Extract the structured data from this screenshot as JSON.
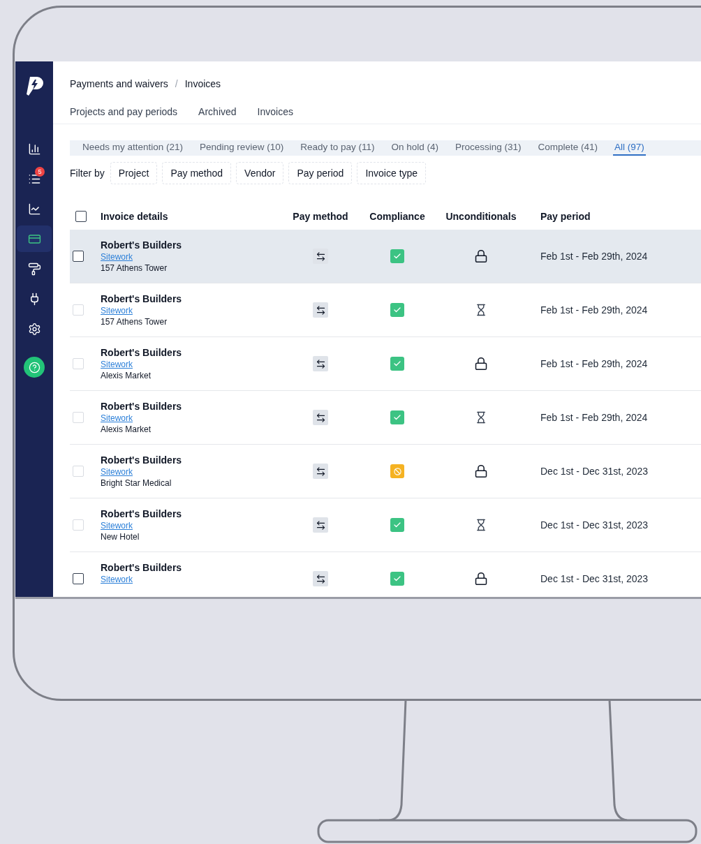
{
  "sidebar": {
    "items": [
      {
        "selected": false
      },
      {
        "selected": false,
        "badge": "5"
      },
      {
        "selected": false
      },
      {
        "selected": true
      },
      {
        "selected": false
      },
      {
        "selected": false
      },
      {
        "selected": false
      }
    ]
  },
  "breadcrumb": [
    "Payments and waivers",
    "Invoices"
  ],
  "breadcrumb_separator": "/",
  "subnav": [
    {
      "label": "Projects and pay periods"
    },
    {
      "label": "Archived"
    },
    {
      "label": "Invoices"
    }
  ],
  "status_tabs": [
    {
      "label": "Needs my attention (21)",
      "selected": false
    },
    {
      "label": "Pending review (10)",
      "selected": false
    },
    {
      "label": "Ready to pay (11)",
      "selected": false
    },
    {
      "label": "On hold (4)",
      "selected": false
    },
    {
      "label": "Processing (31)",
      "selected": false
    },
    {
      "label": "Complete (41)",
      "selected": false
    },
    {
      "label": "All (97)",
      "selected": true
    }
  ],
  "filter": {
    "label": "Filter by",
    "chips": [
      "Project",
      "Pay method",
      "Vendor",
      "Pay period",
      "Invoice type"
    ]
  },
  "table": {
    "header_checkbox": {
      "checked": false
    },
    "columns": [
      "Invoice details",
      "Pay method",
      "Compliance",
      "Unconditionals",
      "Pay period"
    ],
    "rows": [
      {
        "highlighted": true,
        "disabled": false,
        "vendor": "Robert's Builders",
        "trade": "Sitework",
        "project": "157 Athens Tower",
        "compliance": {
          "kind": "ok"
        },
        "unconditional": {
          "kind": "lock"
        },
        "pay_period": "Feb 1st - Feb 29th, 2024"
      },
      {
        "highlighted": false,
        "disabled": true,
        "vendor": "Robert's Builders",
        "trade": "Sitework",
        "project": "157 Athens Tower",
        "compliance": {
          "kind": "ok"
        },
        "unconditional": {
          "kind": "pending"
        },
        "pay_period": "Feb 1st - Feb 29th, 2024"
      },
      {
        "highlighted": false,
        "disabled": true,
        "vendor": "Robert's Builders",
        "trade": "Sitework",
        "project": "Alexis Market",
        "compliance": {
          "kind": "ok"
        },
        "unconditional": {
          "kind": "lock"
        },
        "pay_period": "Feb 1st - Feb 29th, 2024"
      },
      {
        "highlighted": false,
        "disabled": true,
        "vendor": "Robert's Builders",
        "trade": "Sitework",
        "project": "Alexis Market",
        "compliance": {
          "kind": "ok"
        },
        "unconditional": {
          "kind": "pending"
        },
        "pay_period": "Feb 1st - Feb 29th, 2024"
      },
      {
        "highlighted": false,
        "disabled": true,
        "vendor": "Robert's Builders",
        "trade": "Sitework",
        "project": "Bright Star Medical",
        "compliance": {
          "kind": "blocked"
        },
        "unconditional": {
          "kind": "lock"
        },
        "pay_period": "Dec 1st - Dec 31st, 2023"
      },
      {
        "highlighted": false,
        "disabled": true,
        "vendor": "Robert's Builders",
        "trade": "Sitework",
        "project": "New Hotel",
        "compliance": {
          "kind": "ok"
        },
        "unconditional": {
          "kind": "pending"
        },
        "pay_period": "Dec 1st - Dec 31st, 2023"
      },
      {
        "highlighted": false,
        "disabled": false,
        "vendor": "Robert's Builders",
        "trade": "Sitework",
        "compliance": {
          "kind": "ok"
        },
        "unconditional": {
          "kind": "lock"
        },
        "pay_period": "Dec 1st - Dec 31st, 2023"
      }
    ]
  }
}
